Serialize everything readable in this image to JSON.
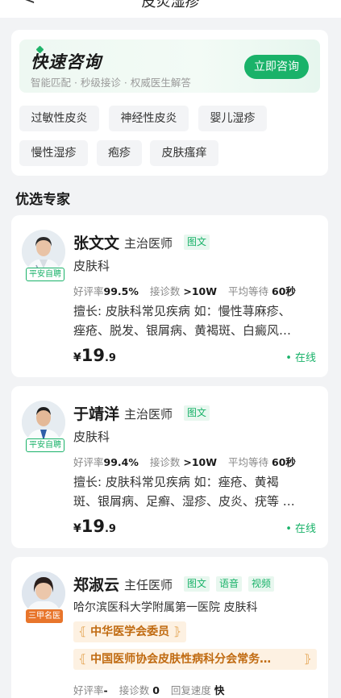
{
  "header": {
    "back_glyph": "<",
    "title": "皮炎湿疹"
  },
  "quick_consult": {
    "title": "快速咨询",
    "subtitle": "智能匹配 · 秒级接诊 · 权威医生解答",
    "button": "立即咨询",
    "tags": [
      "过敏性皮炎",
      "神经性皮炎",
      "婴儿湿疹",
      "慢性湿疹",
      "疱疹",
      "皮肤瘙痒"
    ]
  },
  "section_title": "优选专家",
  "doctors": [
    {
      "name": "张文文",
      "title": "主治医师",
      "chips": [
        "图文"
      ],
      "dept": "皮肤科",
      "badge": "平安自聘",
      "stats": {
        "rating_label": "好评率",
        "rating": "99.5%",
        "count_label": "接诊数",
        "count": ">10W",
        "wait_label": "平均等待",
        "wait": "60秒"
      },
      "desc_line1": "擅长: 皮肤科常见疾病 如：慢性荨麻疹、",
      "desc_line2": "痤疮、脱发、银屑病、黄褐斑、白癜风…",
      "price_yen": "¥",
      "price_int": "19",
      "price_dec": ".9",
      "status": "• 在线"
    },
    {
      "name": "于靖洋",
      "title": "主治医师",
      "chips": [
        "图文"
      ],
      "dept": "皮肤科",
      "badge": "平安自聘",
      "stats": {
        "rating_label": "好评率",
        "rating": "99.4%",
        "count_label": "接诊数",
        "count": ">10W",
        "wait_label": "平均等待",
        "wait": "60秒"
      },
      "desc_line1": "擅长: 皮肤科常见疾病 如：痤疮、黄褐",
      "desc_line2": "斑、银屑病、足癣、湿疹、皮炎、疣等 …",
      "price_yen": "¥",
      "price_int": "19",
      "price_dec": ".9",
      "status": "• 在线"
    },
    {
      "name": "郑淑云",
      "title": "主任医师",
      "chips": [
        "图文",
        "语音",
        "视频"
      ],
      "dept": "哈尔滨医科大学附属第一医院  皮肤科",
      "badge": "三甲名医",
      "honors": [
        "中华医学会委员",
        "中国医师协会皮肤性病科分会常务…"
      ],
      "stats": {
        "rating_label": "好评率",
        "rating": "-",
        "count_label": "接诊数",
        "count": "0",
        "wait_label": "回复速度",
        "wait": "快"
      }
    }
  ],
  "colors": {
    "accent": "#19b269",
    "orange": "#e8752b",
    "honor_bg": "#fdf1e2"
  }
}
